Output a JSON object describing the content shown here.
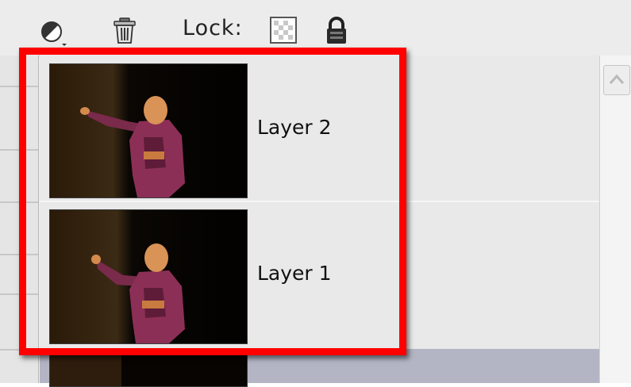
{
  "toolbar": {
    "adjustment_icon": "adjustment-layer-icon",
    "trash_icon": "trash-icon",
    "lock_label": "Lock:",
    "lock_pixels_icon": "lock-transparent-pixels-icon",
    "lock_all_icon": "padlock-icon"
  },
  "layers": [
    {
      "name": "Layer 2",
      "thumbnail": "performer-on-stage-thumbnail"
    },
    {
      "name": "Layer 1",
      "thumbnail": "performer-on-stage-thumbnail"
    },
    {
      "name": "",
      "thumbnail": "performer-on-stage-thumbnail",
      "selected": true
    }
  ],
  "scrollbar": {
    "up_icon": "chevron-up-icon"
  },
  "annotation": {
    "color": "#ff0000"
  }
}
